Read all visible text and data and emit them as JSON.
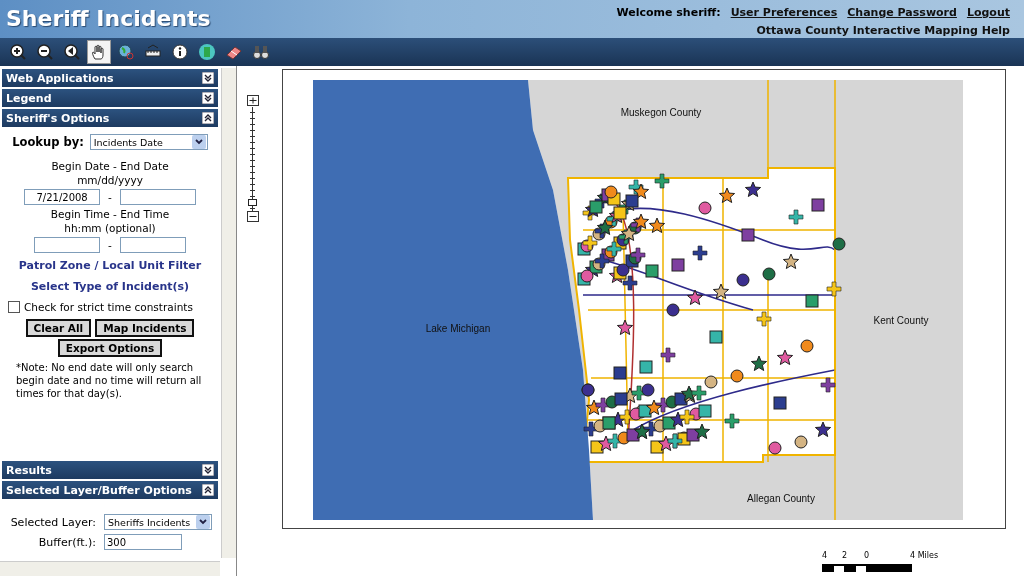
{
  "header": {
    "title": "Sheriff Incidents",
    "welcome": "Welcome sheriff:",
    "links": [
      "User Preferences",
      "Change Password",
      "Logout"
    ],
    "help": "Ottawa County Interactive Mapping Help"
  },
  "toolbar": [
    {
      "kind": "zoom-in",
      "selected": false
    },
    {
      "kind": "zoom-out",
      "selected": false
    },
    {
      "kind": "back",
      "selected": false
    },
    {
      "kind": "pan",
      "selected": true
    },
    {
      "kind": "globe",
      "selected": false
    },
    {
      "kind": "measure",
      "selected": false
    },
    {
      "kind": "info",
      "selected": false
    },
    {
      "kind": "select",
      "selected": false
    },
    {
      "kind": "eraser",
      "selected": false
    },
    {
      "kind": "binoculars",
      "selected": false
    }
  ],
  "sidebar": {
    "sections_top": [
      {
        "title": "Web Applications",
        "expanded": false
      },
      {
        "title": "Legend",
        "expanded": false
      },
      {
        "title": "Sheriff's Options",
        "expanded": true
      }
    ],
    "options": {
      "lookup_label": "Lookup by:",
      "lookup_value": "Incidents Date",
      "date_heading": "Begin Date - End Date",
      "date_format": "mm/dd/yyyy",
      "begin_date": "7/21/2008",
      "dash": "-",
      "time_heading": "Begin Time - End Time",
      "time_format": "hh:mm (optional)",
      "links": [
        "Patrol Zone / Local Unit Filter",
        "Select Type of Incident(s)"
      ],
      "strict": {
        "label": "Check for strict time constraints",
        "checked": false
      },
      "buttons": [
        "Clear All",
        "Map Incidents",
        "Export Options"
      ],
      "note": "*Note: No end date will only search begin date and no time will return all times for that day(s)."
    },
    "sections_bottom": [
      {
        "title": "Results",
        "expanded": false
      },
      {
        "title": "Selected Layer/Buffer Options",
        "expanded": true
      }
    ],
    "layer": {
      "layer_label": "Selected Layer:",
      "layer_value": "Sheriffs Incidents",
      "buffer_label": "Buffer(ft.):",
      "buffer_value": "300"
    }
  },
  "map": {
    "labels": [
      "Muskegon County",
      "Lake Michigan",
      "Kent County",
      "Allegan County"
    ],
    "zoom": {
      "level": 0.08
    },
    "scale": [
      "4",
      "2",
      "0",
      "4 Miles"
    ]
  }
}
